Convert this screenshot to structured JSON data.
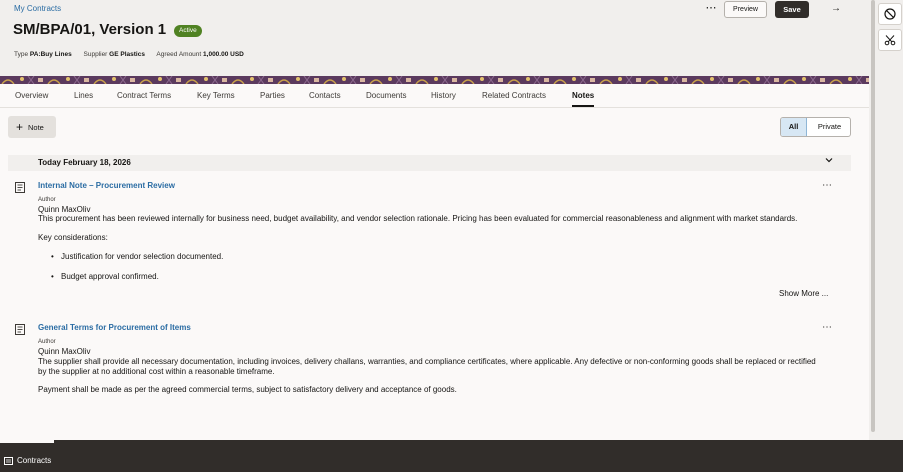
{
  "header": {
    "breadcrumb": "My Contracts",
    "title": "SM/BPA/01, Version 1",
    "status": "Active",
    "meta": [
      {
        "key": "Type",
        "value": "PA:Buy Lines"
      },
      {
        "key": "Supplier",
        "value": "GE Plastics"
      },
      {
        "key": "Agreed Amount",
        "value": "1,000.00 USD"
      }
    ],
    "more_label": "⋯",
    "preview_label": "Preview",
    "save_label": "Save",
    "arrow_label": "→"
  },
  "tabs": [
    "Overview",
    "Lines",
    "Contract Terms",
    "Key Terms",
    "Parties",
    "Contacts",
    "Documents",
    "History",
    "Related Contracts",
    "Notes"
  ],
  "active_tab": "Notes",
  "toolbar": {
    "note_label": "Note",
    "filter_all": "All",
    "filter_private": "Private"
  },
  "date_group": "Today February 18, 2026",
  "notes": [
    {
      "title": "Internal Note – Procurement Review",
      "author_label": "Author",
      "author": "Quinn MaxOliv",
      "body": "This procurement has been reviewed internally for business need, budget availability, and vendor selection rationale. Pricing has been evaluated for commercial reasonableness and alignment with market standards.",
      "considerations_label": "Key considerations:",
      "bullets": [
        "Justification for vendor selection documented.",
        "Budget approval confirmed."
      ],
      "show_more": "Show More ..."
    },
    {
      "title": "General Terms for Procurement of Items",
      "author_label": "Author",
      "author": "Quinn MaxOliv",
      "body_line1": "The supplier shall provide all necessary documentation, including invoices, delivery challans, warranties, and compliance certificates, where applicable. Any defective or non-conforming goods shall be replaced or rectified",
      "body_line2": "by the supplier at no additional cost within a reasonable timeframe.",
      "body2": "Payment shall be made as per the agreed commercial terms, subject to satisfactory delivery and acceptance of goods."
    }
  ],
  "footer": {
    "label": "Contracts"
  },
  "colors": {
    "link": "#2a6ca3",
    "active_badge": "#508223",
    "save_button": "#312d2a",
    "band": "#5b3a5e",
    "footer": "#312d2a"
  }
}
